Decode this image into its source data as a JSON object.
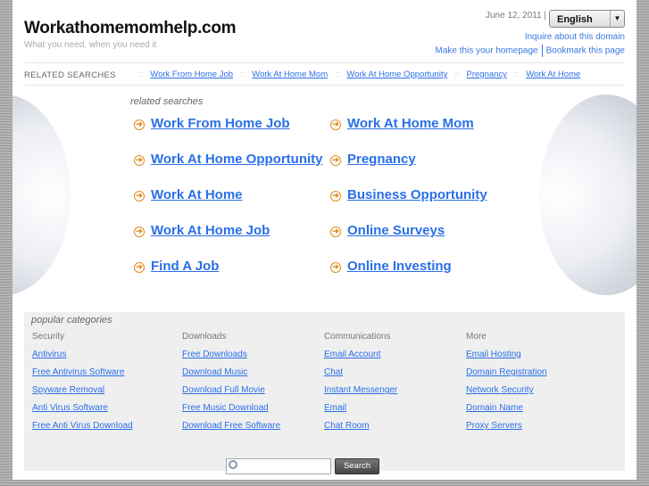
{
  "header": {
    "title": "Workathomemomhelp.com",
    "tagline": "What you need, when you need it",
    "date": "June 12, 2011 |",
    "language": "English",
    "inquire": "Inquire about this domain",
    "homepage": "Make this your homepage",
    "bookmark": "Bookmark this page"
  },
  "related_bar": {
    "label": "RELATED SEARCHES",
    "items": [
      "Work From Home Job",
      "Work At Home Mom",
      "Work At Home Opportunity",
      "Pregnancy",
      "Work At Home"
    ]
  },
  "related": {
    "heading": "related searches",
    "items": [
      "Work From Home Job",
      "Work At Home Mom",
      "Work At Home Opportunity",
      "Pregnancy",
      "Work At Home",
      "Business Opportunity",
      "Work At Home Job",
      "Online Surveys",
      "Find A Job",
      "Online Investing"
    ]
  },
  "popular": {
    "heading": "popular categories",
    "columns": [
      {
        "title": "Security",
        "links": [
          "Antivirus",
          "Free Antivirus Software",
          "Spyware Removal",
          "Anti Virus Software",
          "Free Anti Virus Download"
        ]
      },
      {
        "title": "Downloads",
        "links": [
          "Free Downloads",
          "Download Music",
          "Download Full Movie",
          "Free Music Download",
          "Download Free Software"
        ]
      },
      {
        "title": "Communications",
        "links": [
          "Email Account",
          "Chat",
          "Instant Messenger",
          "Email",
          "Chat Room"
        ]
      },
      {
        "title": "More",
        "links": [
          "Email Hosting",
          "Domain Registration",
          "Network Security",
          "Domain Name",
          "Proxy Servers"
        ]
      }
    ]
  },
  "search": {
    "button": "Search",
    "value": ""
  },
  "colors": {
    "link": "#2a6fe8",
    "arrow": "#e08a1e"
  }
}
